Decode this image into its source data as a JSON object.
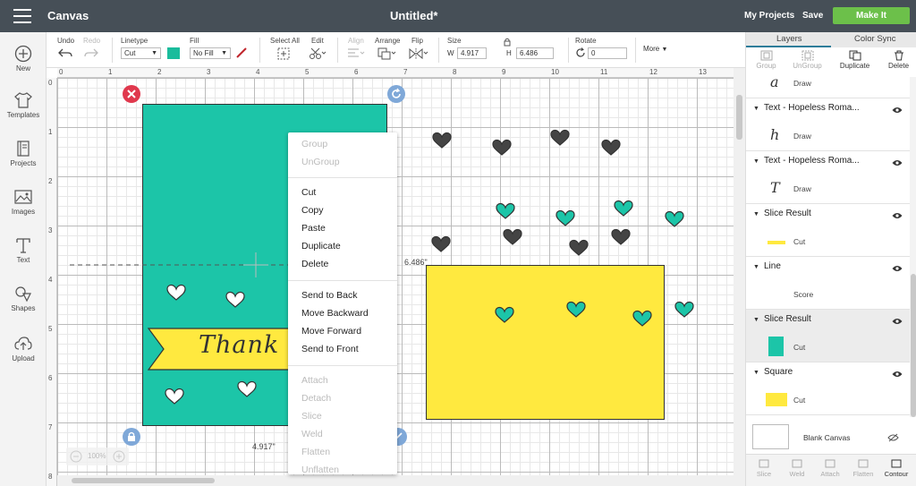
{
  "topbar": {
    "app": "Canvas",
    "doc_title": "Untitled*",
    "my_projects": "My Projects",
    "save": "Save",
    "make_it": "Make It"
  },
  "left_nav": [
    {
      "label": "New",
      "icon": "plus-circle-icon"
    },
    {
      "label": "Templates",
      "icon": "tshirt-icon"
    },
    {
      "label": "Projects",
      "icon": "book-icon"
    },
    {
      "label": "Images",
      "icon": "image-icon"
    },
    {
      "label": "Text",
      "icon": "text-t-icon"
    },
    {
      "label": "Shapes",
      "icon": "shapes-icon"
    },
    {
      "label": "Upload",
      "icon": "cloud-upload-icon"
    }
  ],
  "toolbar": {
    "undo": "Undo",
    "redo": "Redo",
    "linetype_label": "Linetype",
    "linetype_value": "Cut",
    "fill_label": "Fill",
    "fill_value": "No Fill",
    "fill_swatch": "#1abc9c",
    "select_all": "Select All",
    "edit": "Edit",
    "align": "Align",
    "arrange": "Arrange",
    "flip": "Flip",
    "size": "Size",
    "w_label": "W",
    "w_value": "4.917",
    "h_label": "H",
    "h_value": "6.486",
    "rotate": "Rotate",
    "rotate_value": "0",
    "more": "More"
  },
  "ruler": {
    "h_ticks": [
      "0",
      "1",
      "2",
      "3",
      "4",
      "5",
      "6",
      "7",
      "8",
      "9",
      "10",
      "11",
      "12",
      "13"
    ],
    "v_ticks": [
      "0",
      "1",
      "2",
      "3",
      "4",
      "5",
      "6",
      "7",
      "8"
    ]
  },
  "canvas": {
    "height_label": "6.486\"",
    "width_label": "4.917\"",
    "zoom": "100%",
    "card_text": "Thank Y",
    "teal": "#1cc5a8",
    "yellow": "#ffe93f",
    "dark_heart": "#444444"
  },
  "context_menu": {
    "items": [
      {
        "label": "Group",
        "enabled": false
      },
      {
        "label": "UnGroup",
        "enabled": false
      },
      {
        "label": "Cut",
        "enabled": true
      },
      {
        "label": "Copy",
        "enabled": true
      },
      {
        "label": "Paste",
        "enabled": true
      },
      {
        "label": "Duplicate",
        "enabled": true
      },
      {
        "label": "Delete",
        "enabled": true
      },
      {
        "label": "Send to Back",
        "enabled": true
      },
      {
        "label": "Move Backward",
        "enabled": true
      },
      {
        "label": "Move Forward",
        "enabled": true
      },
      {
        "label": "Send to Front",
        "enabled": true
      },
      {
        "label": "Attach",
        "enabled": false
      },
      {
        "label": "Detach",
        "enabled": false
      },
      {
        "label": "Slice",
        "enabled": false
      },
      {
        "label": "Weld",
        "enabled": false
      },
      {
        "label": "Flatten",
        "enabled": false
      },
      {
        "label": "Unflatten",
        "enabled": false
      }
    ]
  },
  "panel": {
    "tab_layers": "Layers",
    "tab_color_sync": "Color Sync",
    "group": "Group",
    "ungroup": "UnGroup",
    "duplicate": "Duplicate",
    "delete": "Delete",
    "layers": [
      {
        "title": "",
        "sub": "Draw"
      },
      {
        "title": "Text - Hopeless Roma...",
        "sub": "Draw"
      },
      {
        "title": "Text - Hopeless Roma...",
        "sub": "Draw"
      },
      {
        "title": "Slice Result",
        "sub": "Cut"
      },
      {
        "title": "Line",
        "sub": "Score"
      },
      {
        "title": "Slice Result",
        "sub": "Cut"
      },
      {
        "title": "Square",
        "sub": "Cut"
      }
    ],
    "blank_canvas": "Blank Canvas",
    "bottom": [
      "Slice",
      "Weld",
      "Attach",
      "Flatten",
      "Contour"
    ]
  }
}
